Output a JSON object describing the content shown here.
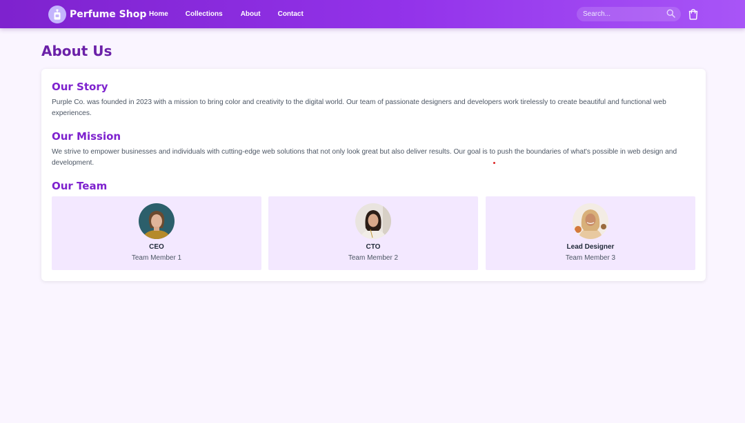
{
  "header": {
    "brand": "Perfume Shop",
    "nav": [
      "Home",
      "Collections",
      "About",
      "Contact"
    ],
    "search_placeholder": "Search..."
  },
  "page": {
    "title": "About Us"
  },
  "sections": {
    "story": {
      "heading": "Our Story",
      "text": "Purple Co. was founded in 2023 with a mission to bring color and creativity to the digital world. Our team of passionate designers and developers work tirelessly to create beautiful and functional web experiences."
    },
    "mission": {
      "heading": "Our Mission",
      "text": "We strive to empower businesses and individuals with cutting-edge web solutions that not only look great but also deliver results. Our goal is to push the boundaries of what's possible in web design and development."
    },
    "team": {
      "heading": "Our Team",
      "members": [
        {
          "role": "CEO",
          "name": "Team Member 1"
        },
        {
          "role": "CTO",
          "name": "Team Member 2"
        },
        {
          "role": "Lead Designer",
          "name": "Team Member 3"
        }
      ]
    }
  },
  "icons": {
    "logo": "perfume-bottle-icon",
    "search": "search-icon",
    "cart": "shopping-bag-icon"
  },
  "colors": {
    "nav_start": "#7e22ce",
    "nav_end": "#a855f7",
    "heading": "#7e22ce",
    "page_bg": "#faf5ff",
    "team_card_bg": "#f3e8ff"
  }
}
